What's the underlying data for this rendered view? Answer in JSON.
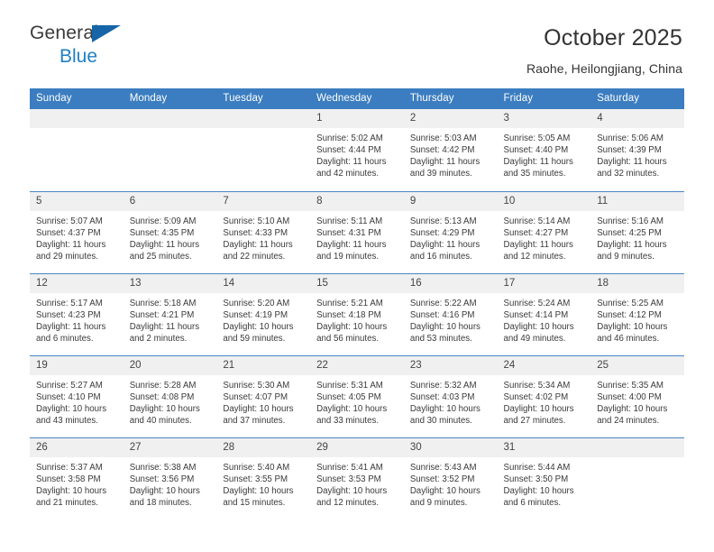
{
  "brand": {
    "name_top": "General",
    "name_bottom": "Blue",
    "accent_color": "#1f7fc4",
    "triangle_color": "#1565a8"
  },
  "header": {
    "title": "October 2025",
    "subtitle": "Raohe, Heilongjiang, China",
    "header_bg": "#3b7dc0",
    "cell_header_bg": "#f0f0f0"
  },
  "weekday_headers": [
    "Sunday",
    "Monday",
    "Tuesday",
    "Wednesday",
    "Thursday",
    "Friday",
    "Saturday"
  ],
  "weeks": [
    [
      {
        "day": "",
        "empty": true
      },
      {
        "day": "",
        "empty": true
      },
      {
        "day": "",
        "empty": true
      },
      {
        "day": "1",
        "sunrise": "Sunrise: 5:02 AM",
        "sunset": "Sunset: 4:44 PM",
        "daylight1": "Daylight: 11 hours",
        "daylight2": "and 42 minutes."
      },
      {
        "day": "2",
        "sunrise": "Sunrise: 5:03 AM",
        "sunset": "Sunset: 4:42 PM",
        "daylight1": "Daylight: 11 hours",
        "daylight2": "and 39 minutes."
      },
      {
        "day": "3",
        "sunrise": "Sunrise: 5:05 AM",
        "sunset": "Sunset: 4:40 PM",
        "daylight1": "Daylight: 11 hours",
        "daylight2": "and 35 minutes."
      },
      {
        "day": "4",
        "sunrise": "Sunrise: 5:06 AM",
        "sunset": "Sunset: 4:39 PM",
        "daylight1": "Daylight: 11 hours",
        "daylight2": "and 32 minutes."
      }
    ],
    [
      {
        "day": "5",
        "sunrise": "Sunrise: 5:07 AM",
        "sunset": "Sunset: 4:37 PM",
        "daylight1": "Daylight: 11 hours",
        "daylight2": "and 29 minutes."
      },
      {
        "day": "6",
        "sunrise": "Sunrise: 5:09 AM",
        "sunset": "Sunset: 4:35 PM",
        "daylight1": "Daylight: 11 hours",
        "daylight2": "and 25 minutes."
      },
      {
        "day": "7",
        "sunrise": "Sunrise: 5:10 AM",
        "sunset": "Sunset: 4:33 PM",
        "daylight1": "Daylight: 11 hours",
        "daylight2": "and 22 minutes."
      },
      {
        "day": "8",
        "sunrise": "Sunrise: 5:11 AM",
        "sunset": "Sunset: 4:31 PM",
        "daylight1": "Daylight: 11 hours",
        "daylight2": "and 19 minutes."
      },
      {
        "day": "9",
        "sunrise": "Sunrise: 5:13 AM",
        "sunset": "Sunset: 4:29 PM",
        "daylight1": "Daylight: 11 hours",
        "daylight2": "and 16 minutes."
      },
      {
        "day": "10",
        "sunrise": "Sunrise: 5:14 AM",
        "sunset": "Sunset: 4:27 PM",
        "daylight1": "Daylight: 11 hours",
        "daylight2": "and 12 minutes."
      },
      {
        "day": "11",
        "sunrise": "Sunrise: 5:16 AM",
        "sunset": "Sunset: 4:25 PM",
        "daylight1": "Daylight: 11 hours",
        "daylight2": "and 9 minutes."
      }
    ],
    [
      {
        "day": "12",
        "sunrise": "Sunrise: 5:17 AM",
        "sunset": "Sunset: 4:23 PM",
        "daylight1": "Daylight: 11 hours",
        "daylight2": "and 6 minutes."
      },
      {
        "day": "13",
        "sunrise": "Sunrise: 5:18 AM",
        "sunset": "Sunset: 4:21 PM",
        "daylight1": "Daylight: 11 hours",
        "daylight2": "and 2 minutes."
      },
      {
        "day": "14",
        "sunrise": "Sunrise: 5:20 AM",
        "sunset": "Sunset: 4:19 PM",
        "daylight1": "Daylight: 10 hours",
        "daylight2": "and 59 minutes."
      },
      {
        "day": "15",
        "sunrise": "Sunrise: 5:21 AM",
        "sunset": "Sunset: 4:18 PM",
        "daylight1": "Daylight: 10 hours",
        "daylight2": "and 56 minutes."
      },
      {
        "day": "16",
        "sunrise": "Sunrise: 5:22 AM",
        "sunset": "Sunset: 4:16 PM",
        "daylight1": "Daylight: 10 hours",
        "daylight2": "and 53 minutes."
      },
      {
        "day": "17",
        "sunrise": "Sunrise: 5:24 AM",
        "sunset": "Sunset: 4:14 PM",
        "daylight1": "Daylight: 10 hours",
        "daylight2": "and 49 minutes."
      },
      {
        "day": "18",
        "sunrise": "Sunrise: 5:25 AM",
        "sunset": "Sunset: 4:12 PM",
        "daylight1": "Daylight: 10 hours",
        "daylight2": "and 46 minutes."
      }
    ],
    [
      {
        "day": "19",
        "sunrise": "Sunrise: 5:27 AM",
        "sunset": "Sunset: 4:10 PM",
        "daylight1": "Daylight: 10 hours",
        "daylight2": "and 43 minutes."
      },
      {
        "day": "20",
        "sunrise": "Sunrise: 5:28 AM",
        "sunset": "Sunset: 4:08 PM",
        "daylight1": "Daylight: 10 hours",
        "daylight2": "and 40 minutes."
      },
      {
        "day": "21",
        "sunrise": "Sunrise: 5:30 AM",
        "sunset": "Sunset: 4:07 PM",
        "daylight1": "Daylight: 10 hours",
        "daylight2": "and 37 minutes."
      },
      {
        "day": "22",
        "sunrise": "Sunrise: 5:31 AM",
        "sunset": "Sunset: 4:05 PM",
        "daylight1": "Daylight: 10 hours",
        "daylight2": "and 33 minutes."
      },
      {
        "day": "23",
        "sunrise": "Sunrise: 5:32 AM",
        "sunset": "Sunset: 4:03 PM",
        "daylight1": "Daylight: 10 hours",
        "daylight2": "and 30 minutes."
      },
      {
        "day": "24",
        "sunrise": "Sunrise: 5:34 AM",
        "sunset": "Sunset: 4:02 PM",
        "daylight1": "Daylight: 10 hours",
        "daylight2": "and 27 minutes."
      },
      {
        "day": "25",
        "sunrise": "Sunrise: 5:35 AM",
        "sunset": "Sunset: 4:00 PM",
        "daylight1": "Daylight: 10 hours",
        "daylight2": "and 24 minutes."
      }
    ],
    [
      {
        "day": "26",
        "sunrise": "Sunrise: 5:37 AM",
        "sunset": "Sunset: 3:58 PM",
        "daylight1": "Daylight: 10 hours",
        "daylight2": "and 21 minutes."
      },
      {
        "day": "27",
        "sunrise": "Sunrise: 5:38 AM",
        "sunset": "Sunset: 3:56 PM",
        "daylight1": "Daylight: 10 hours",
        "daylight2": "and 18 minutes."
      },
      {
        "day": "28",
        "sunrise": "Sunrise: 5:40 AM",
        "sunset": "Sunset: 3:55 PM",
        "daylight1": "Daylight: 10 hours",
        "daylight2": "and 15 minutes."
      },
      {
        "day": "29",
        "sunrise": "Sunrise: 5:41 AM",
        "sunset": "Sunset: 3:53 PM",
        "daylight1": "Daylight: 10 hours",
        "daylight2": "and 12 minutes."
      },
      {
        "day": "30",
        "sunrise": "Sunrise: 5:43 AM",
        "sunset": "Sunset: 3:52 PM",
        "daylight1": "Daylight: 10 hours",
        "daylight2": "and 9 minutes."
      },
      {
        "day": "31",
        "sunrise": "Sunrise: 5:44 AM",
        "sunset": "Sunset: 3:50 PM",
        "daylight1": "Daylight: 10 hours",
        "daylight2": "and 6 minutes."
      },
      {
        "day": "",
        "empty": true
      }
    ]
  ]
}
